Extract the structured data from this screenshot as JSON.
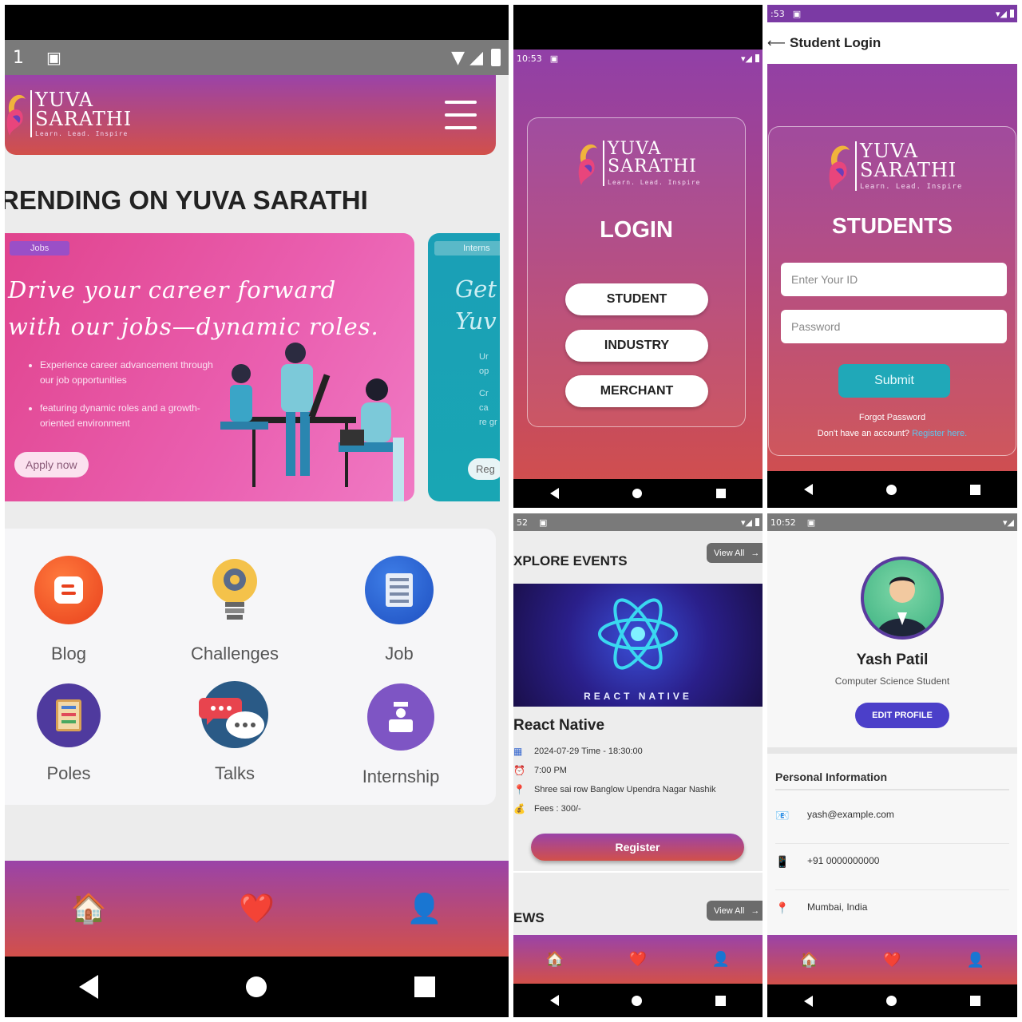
{
  "home": {
    "status_time": "1",
    "logo": {
      "line1": "YUVA",
      "line2": "SARATHI",
      "tagline": "Learn. Lead. Inspire"
    },
    "trending_title": "RENDING ON YUVA SARATHI",
    "card1": {
      "badge": "Jobs",
      "headline": "Drive your career forward with our jobs—dynamic roles.",
      "bullets": [
        "Experience career advancement through our job opportunities",
        "featuring dynamic roles and a growth-oriented environment"
      ],
      "cta": "Apply now"
    },
    "card2": {
      "badge": "Interns",
      "headline": "Get Yuv",
      "bullets": [
        "Ur op",
        "Cr ca re gr"
      ],
      "cta": "Reg"
    },
    "features": [
      {
        "label": "Blog",
        "icon": "blogger-icon"
      },
      {
        "label": "Challenges",
        "icon": "lightbulb-gear-icon"
      },
      {
        "label": "Job",
        "icon": "document-icon"
      },
      {
        "label": "Poles",
        "icon": "clipboard-icon"
      },
      {
        "label": "Talks",
        "icon": "chat-bubbles-icon"
      },
      {
        "label": "Internship",
        "icon": "graduate-icon"
      }
    ],
    "tabs": {
      "home": "🏠",
      "favorites": "❤️",
      "profile": "👤"
    }
  },
  "login": {
    "status_time": "10:53",
    "title": "LOGIN",
    "options": [
      "STUDENT",
      "INDUSTRY",
      "MERCHANT"
    ]
  },
  "student_login": {
    "status_time": ":53",
    "header_title": "Student Login",
    "title": "STUDENTS",
    "id_placeholder": "Enter Your ID",
    "password_placeholder": "Password",
    "submit": "Submit",
    "forgot": "Forgot Password",
    "no_account": "Don't have an account?",
    "register_link": "Register here."
  },
  "events": {
    "status_time": "52",
    "section_title": "XPLORE EVENTS",
    "view_all": "View All",
    "banner_text": "REACT NATIVE",
    "event_title": "React Native",
    "date": "2024-07-29 Time - 18:30:00",
    "time": "7:00 PM",
    "location": "Shree sai row Banglow Upendra Nagar Nashik",
    "fees": "Fees : 300/-",
    "register": "Register",
    "news_title": "EWS",
    "news_view_all": "View All"
  },
  "profile": {
    "status_time": "10:52",
    "name": "Yash Patil",
    "role": "Computer Science Student",
    "edit": "EDIT PROFILE",
    "section": "Personal Information",
    "email": "yash@example.com",
    "phone": "+91 0000000000",
    "location": "Mumbai, India"
  },
  "colors": {
    "gradient_top": "#8a3fb0",
    "gradient_bottom": "#d45049",
    "teal": "#20a8b8",
    "edit_blue": "#4b3fc9"
  }
}
